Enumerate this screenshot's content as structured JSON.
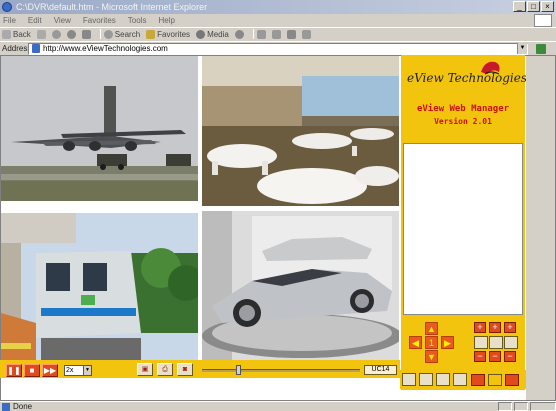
{
  "window": {
    "title": "C:\\DVR\\default.htm - Microsoft Internet Explorer",
    "buttons": [
      "_",
      "□",
      "×"
    ]
  },
  "menu": [
    "File",
    "Edit",
    "View",
    "Favorites",
    "Tools",
    "Help"
  ],
  "toolbar": {
    "back": "Back",
    "search": "Search",
    "favorites": "Favorites",
    "media": "Media"
  },
  "address": {
    "label": "Address",
    "url": "http://www.eViewTechnologies.com"
  },
  "panel": {
    "brand": "eView Technologies",
    "title": "eView Web Manager",
    "version": "Version 2.01",
    "center_digit": "1"
  },
  "controls": {
    "speed": "2x",
    "time": "UC14",
    "playback_position": 0.22
  },
  "status": {
    "text": "Done"
  },
  "colors": {
    "panel_yellow": "#f2c40d",
    "button_orange": "#e04a1c",
    "title_red": "#d01010"
  },
  "icons": [
    "ie-icon",
    "back-icon",
    "forward-icon",
    "stop-icon",
    "refresh-icon",
    "home-icon",
    "search-icon",
    "favorites-icon",
    "media-icon",
    "history-icon",
    "mail-icon",
    "print-icon",
    "edit-icon",
    "go-icon",
    "pause-icon",
    "stop-icon",
    "fast-forward-icon",
    "eview-logo-icon",
    "up-arrow-icon",
    "down-arrow-icon",
    "left-arrow-icon",
    "right-arrow-icon"
  ]
}
